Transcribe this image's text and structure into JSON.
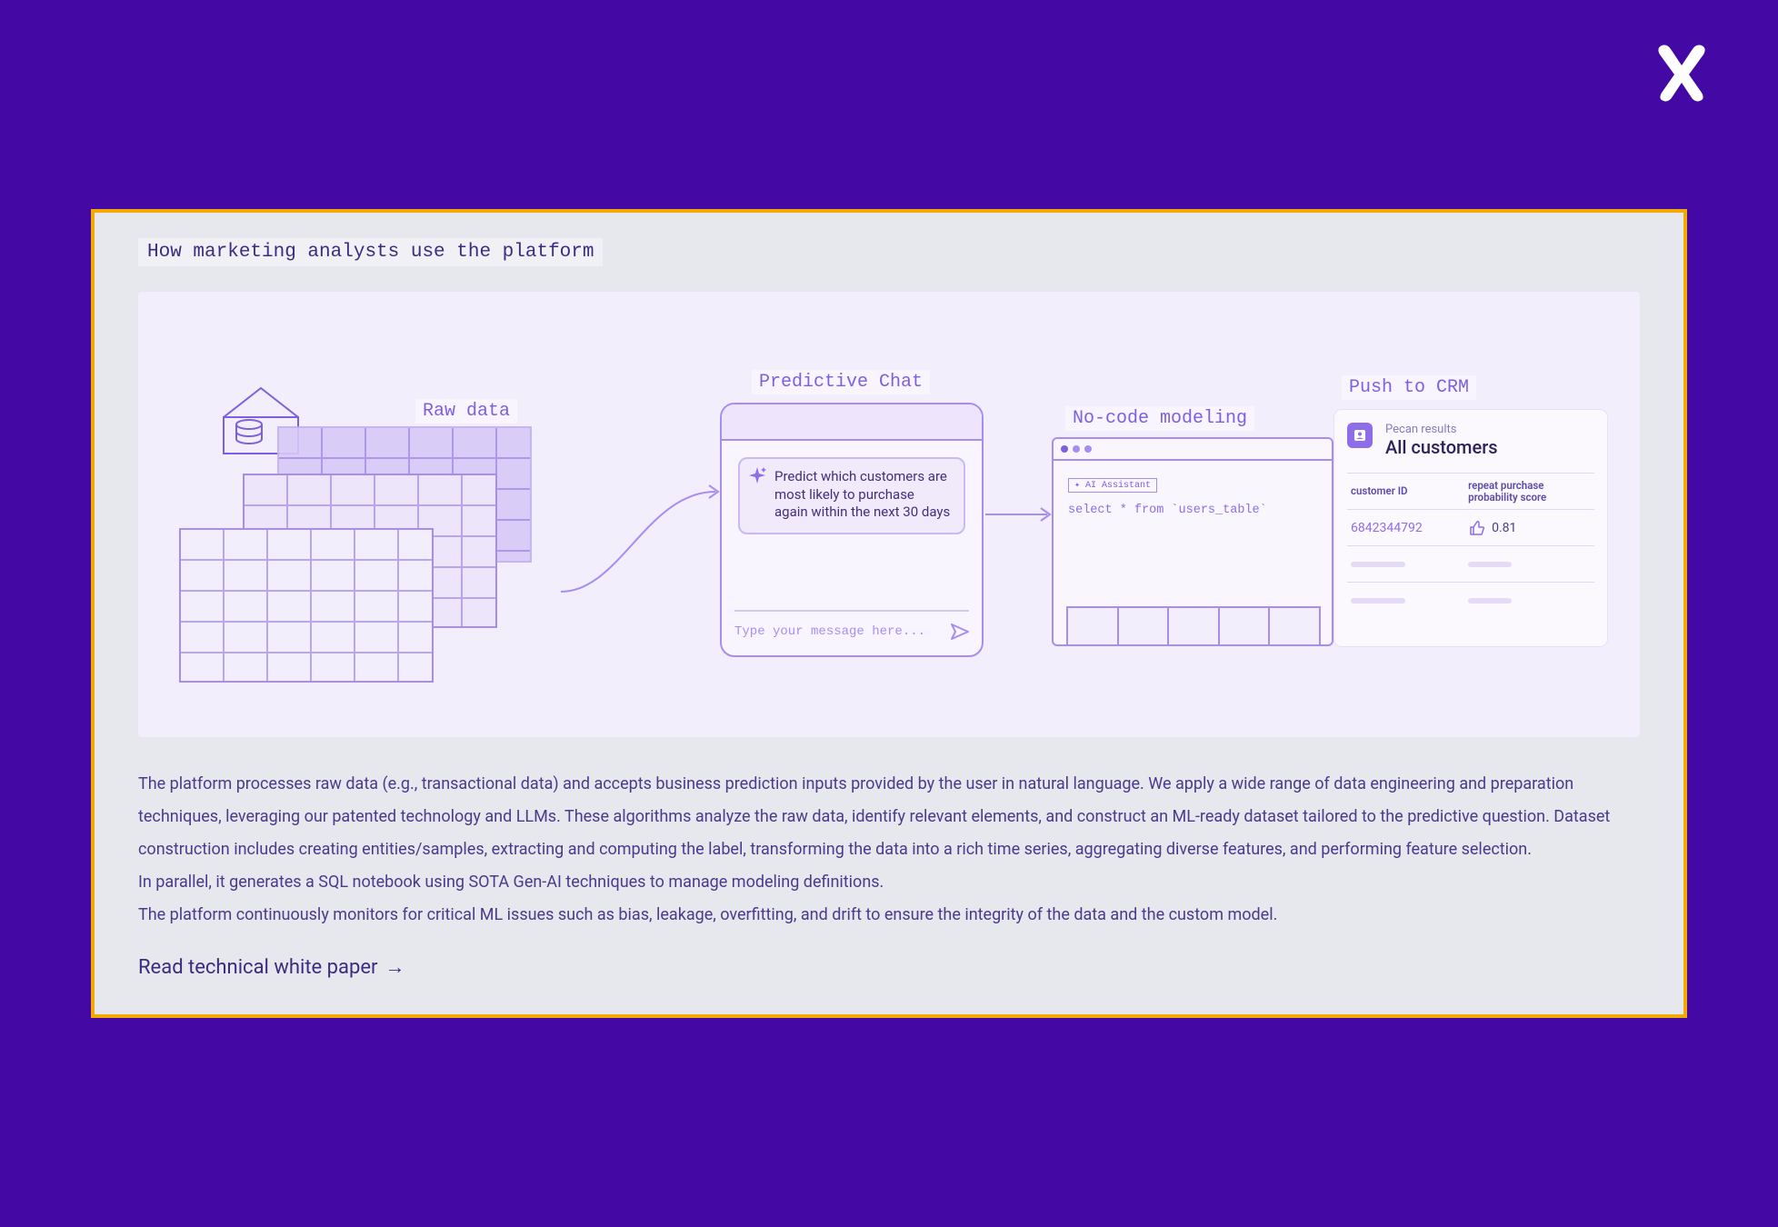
{
  "brand": {
    "logo_icon": "x-mark"
  },
  "section_title": "How marketing analysts use the platform",
  "diagram": {
    "raw_data": {
      "label": "Raw data"
    },
    "predictive_chat": {
      "label": "Predictive Chat",
      "bubble_text": "Predict which customers are most likely to purchase again within the next 30 days",
      "input_placeholder": "Type your message here..."
    },
    "no_code": {
      "label": "No-code modeling",
      "ai_tag": "✦ AI Assistant",
      "code_line": "select * from `users_table`"
    },
    "crm": {
      "label": "Push to CRM",
      "subtitle": "Pecan results",
      "title": "All customers",
      "col1": "customer ID",
      "col2": "repeat purchase probability score",
      "row_id": "6842344792",
      "row_score": "0.81"
    }
  },
  "description": {
    "p1": "The platform processes raw data (e.g., transactional data) and accepts business prediction inputs provided by the user in natural language. We apply a wide range of data engineering and preparation techniques, leveraging our patented technology and LLMs. These algorithms analyze the raw data, identify relevant elements, and construct an ML-ready dataset tailored to the predictive question. Dataset construction includes creating entities/samples, extracting and computing the label, transforming the data into a rich time series, aggregating diverse features, and performing feature selection.",
    "p2": "In parallel, it generates a SQL notebook using SOTA Gen-AI techniques to manage modeling definitions.",
    "p3": "The platform continuously monitors for critical ML issues such as bias, leakage, overfitting, and drift to ensure the integrity of the data and the custom model."
  },
  "cta_label": "Read technical white paper"
}
